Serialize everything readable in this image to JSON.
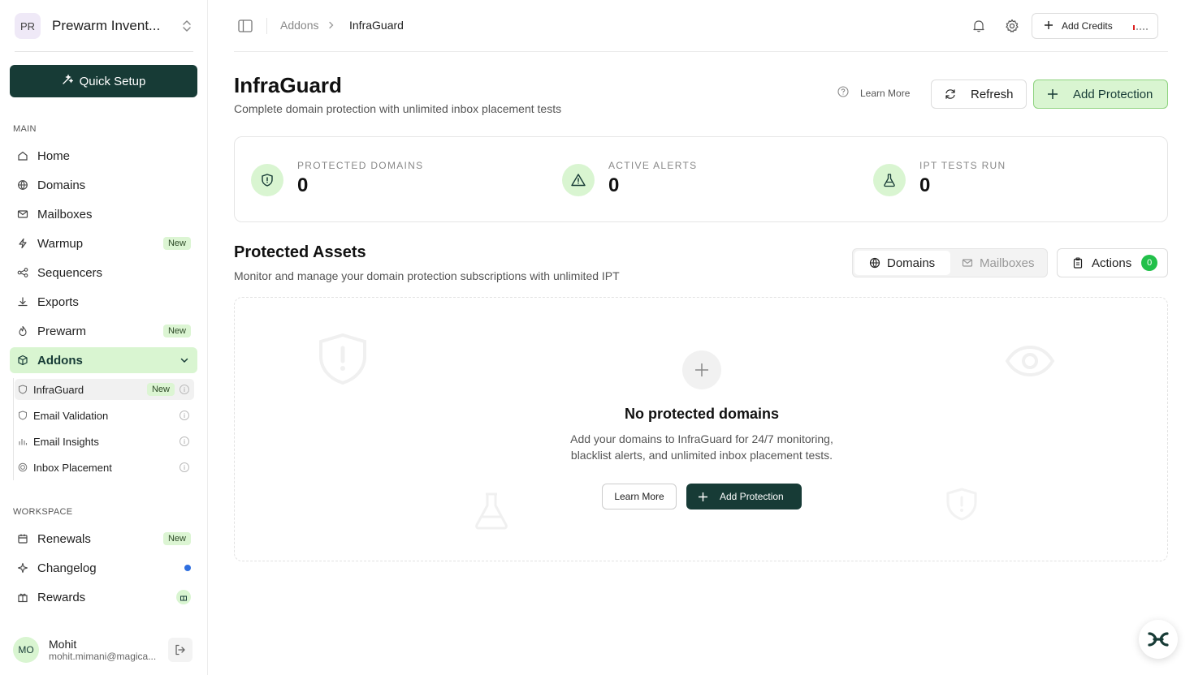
{
  "workspace": {
    "initials": "PR",
    "name": "Prewarm Invent..."
  },
  "quick_setup": "Quick Setup",
  "sidebar": {
    "main_label": "MAIN",
    "items": [
      {
        "label": "Home",
        "icon": "home-icon"
      },
      {
        "label": "Domains",
        "icon": "globe-icon"
      },
      {
        "label": "Mailboxes",
        "icon": "mail-icon"
      },
      {
        "label": "Warmup",
        "icon": "bolt-icon",
        "badge": "New"
      },
      {
        "label": "Sequencers",
        "icon": "sequencer-icon"
      },
      {
        "label": "Exports",
        "icon": "download-icon"
      },
      {
        "label": "Prewarm",
        "icon": "flame-icon",
        "badge": "New"
      },
      {
        "label": "Addons",
        "icon": "package-icon"
      }
    ],
    "sub_items": [
      {
        "label": "InfraGuard",
        "icon": "shield-icon",
        "badge": "New"
      },
      {
        "label": "Email Validation",
        "icon": "shield-check-icon"
      },
      {
        "label": "Email Insights",
        "icon": "bar-chart-icon"
      },
      {
        "label": "Inbox Placement",
        "icon": "target-icon"
      }
    ],
    "workspace_label": "WORKSPACE",
    "workspace_items": [
      {
        "label": "Renewals",
        "icon": "calendar-icon",
        "badge": "New"
      },
      {
        "label": "Changelog",
        "icon": "sparkle-icon"
      },
      {
        "label": "Rewards",
        "icon": "gift-icon"
      }
    ]
  },
  "user": {
    "initials": "MO",
    "name": "Mohit",
    "email": "mohit.mimani@magica..."
  },
  "topbar": {
    "breadcrumb": [
      "Addons",
      "InfraGuard"
    ],
    "add_credits": "Add Credits"
  },
  "header": {
    "title": "InfraGuard",
    "subtitle": "Complete domain protection with unlimited inbox placement tests",
    "learn_more": "Learn More",
    "refresh": "Refresh",
    "add_protection": "Add Protection"
  },
  "stats": [
    {
      "label": "PROTECTED DOMAINS",
      "value": "0",
      "icon": "shield-icon"
    },
    {
      "label": "ACTIVE ALERTS",
      "value": "0",
      "icon": "alert-triangle-icon"
    },
    {
      "label": "IPT TESTS RUN",
      "value": "0",
      "icon": "flask-icon"
    }
  ],
  "assets": {
    "title": "Protected Assets",
    "subtitle": "Monitor and manage your domain protection subscriptions with unlimited IPT",
    "tabs": [
      "Domains",
      "Mailboxes"
    ],
    "actions": "Actions",
    "actions_count": "0"
  },
  "empty": {
    "title": "No protected domains",
    "desc_line1": "Add your domains to InfraGuard for 24/7 monitoring,",
    "desc_line2": "blacklist alerts, and unlimited inbox placement tests.",
    "learn_more": "Learn More",
    "add_protection": "Add Protection"
  },
  "colors": {
    "brand_dark": "#173b36",
    "accent_green": "#d9f5d1",
    "badge_green": "#22c04a"
  }
}
